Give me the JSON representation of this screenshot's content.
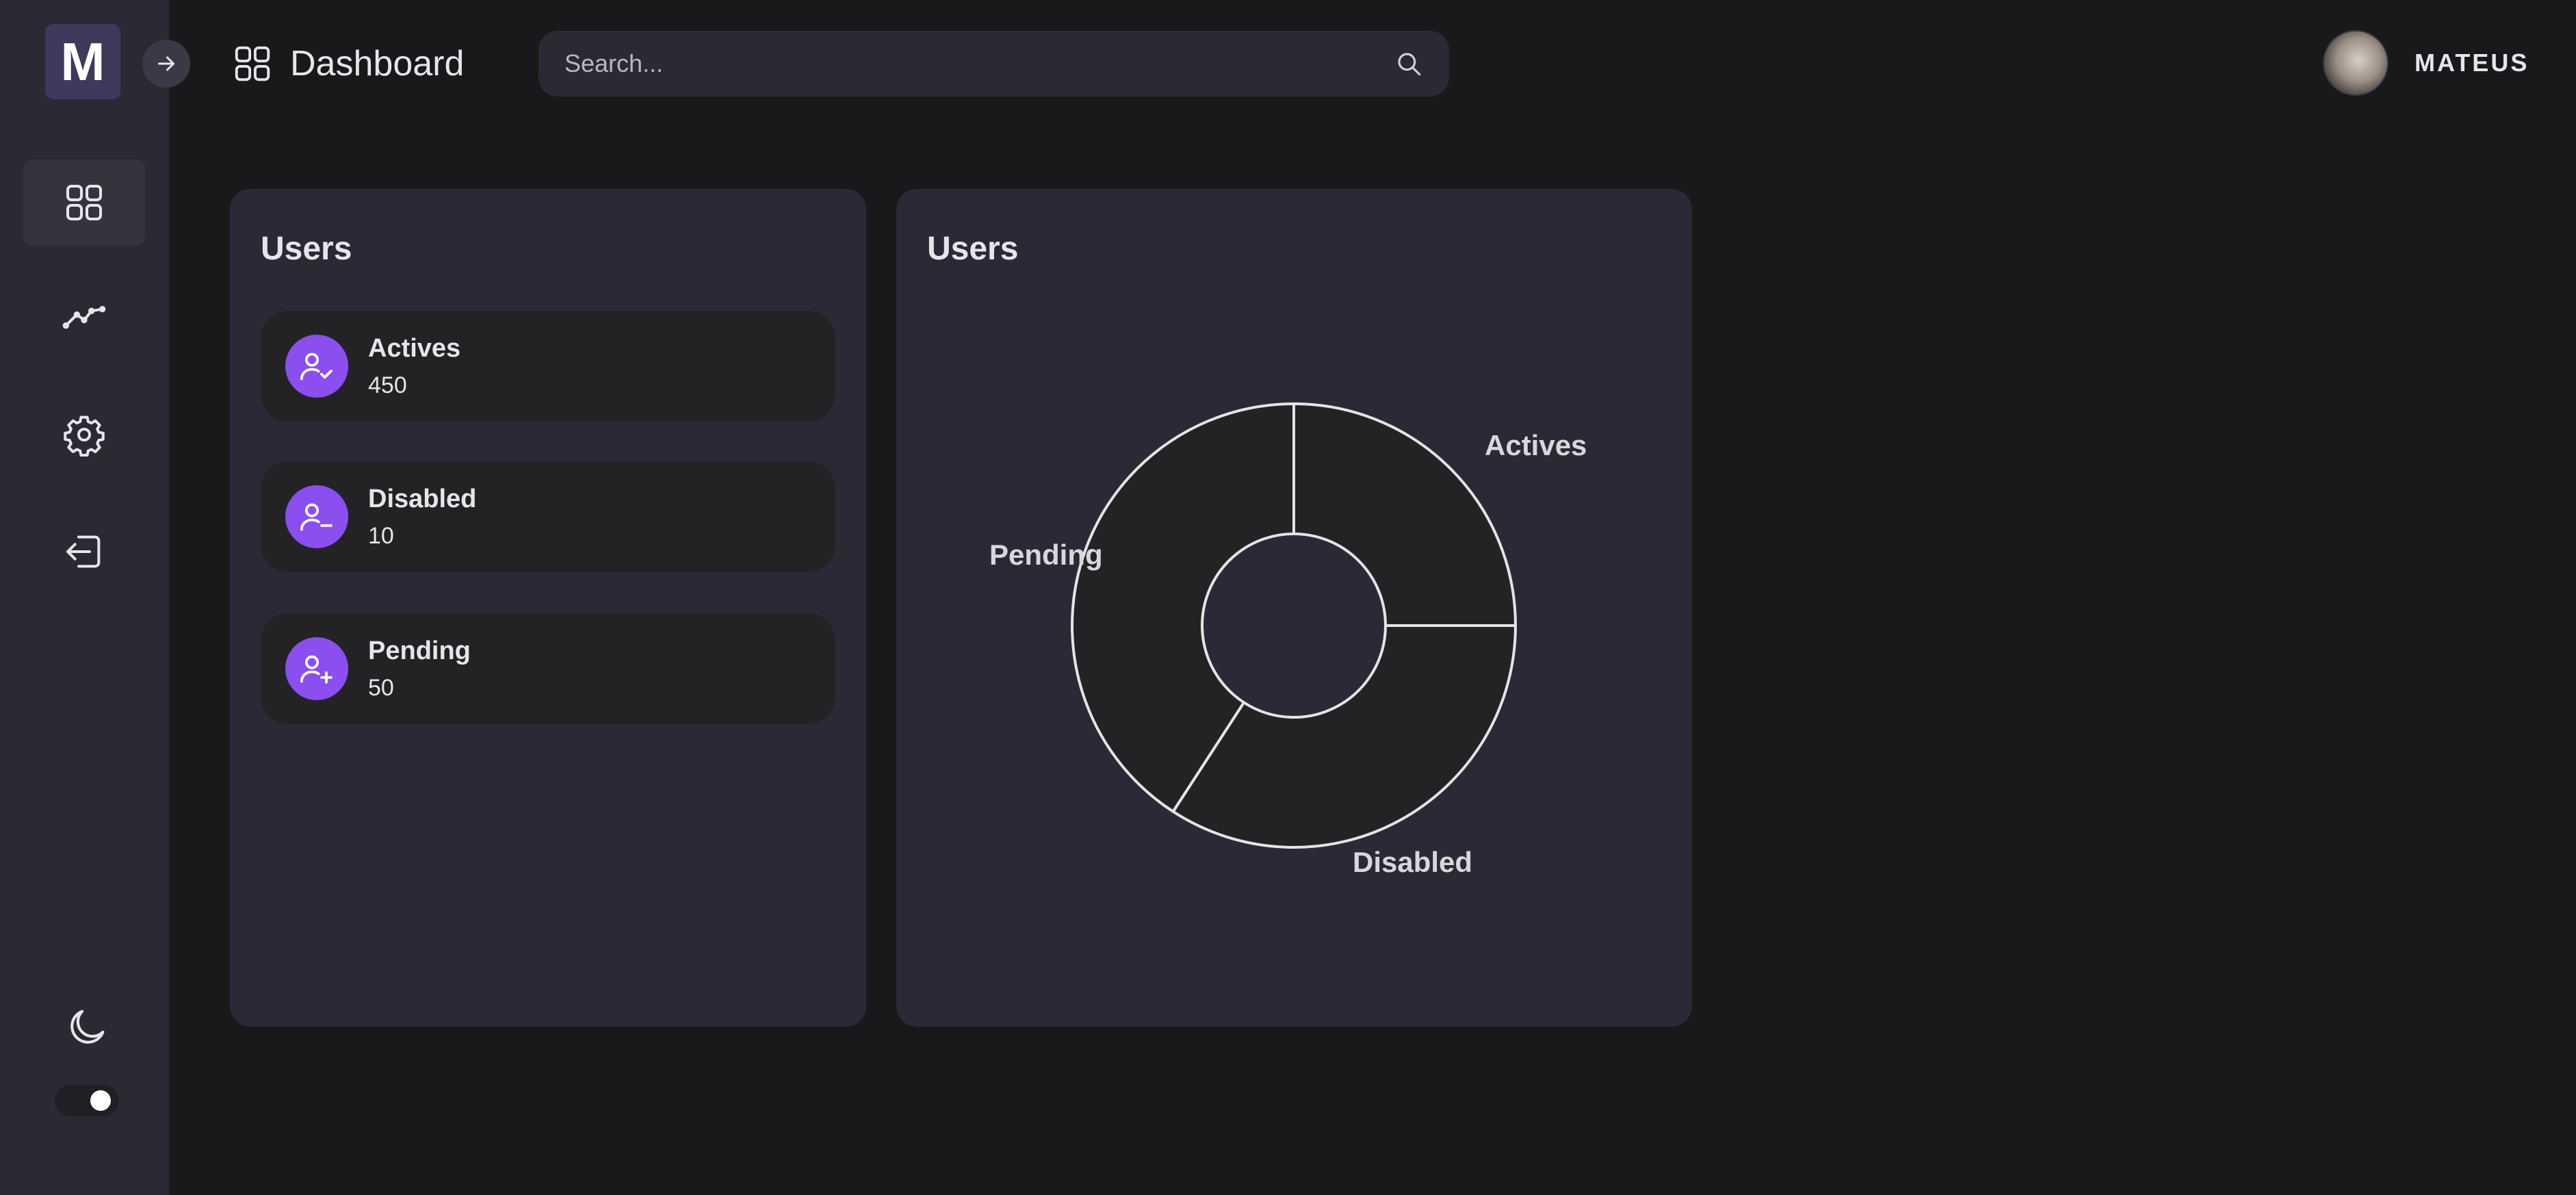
{
  "app": {
    "logo_letter": "M"
  },
  "sidebar": {
    "items": [
      {
        "name": "dashboard",
        "icon": "grid-icon",
        "active": true
      },
      {
        "name": "analytics",
        "icon": "trend-line-icon",
        "active": false
      },
      {
        "name": "settings",
        "icon": "gear-icon",
        "active": false
      },
      {
        "name": "logout",
        "icon": "logout-icon",
        "active": false
      }
    ],
    "theme_toggle": {
      "icon": "moon-icon",
      "dark_mode": true
    }
  },
  "header": {
    "title": "Dashboard",
    "search_placeholder": "Search...",
    "user_name": "MATEUS"
  },
  "stats_card": {
    "title": "Users",
    "items": [
      {
        "label": "Actives",
        "value": "450",
        "icon": "user-check-icon"
      },
      {
        "label": "Disabled",
        "value": "10",
        "icon": "user-minus-icon"
      },
      {
        "label": "Pending",
        "value": "50",
        "icon": "user-plus-icon"
      }
    ]
  },
  "chart_card": {
    "title": "Users"
  },
  "chart_data": {
    "type": "pie",
    "labels": [
      "Actives",
      "Disabled",
      "Pending"
    ],
    "values": [
      90,
      123,
      147
    ],
    "donut": true,
    "title": "Users"
  },
  "colors": {
    "accent": "#8a4fee",
    "background": "#19191c",
    "panel": "#2a2a36",
    "slice_fill": "#232325",
    "slice_stroke": "#e4e4e4"
  }
}
